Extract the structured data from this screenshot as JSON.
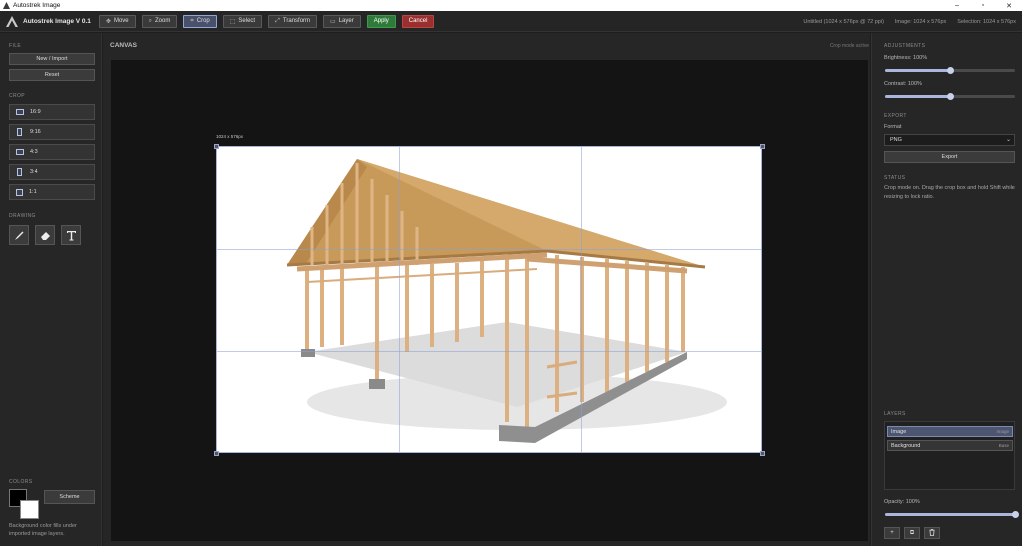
{
  "window": {
    "title": "Autostrek Image",
    "controls": [
      "–",
      "▫",
      "✕"
    ]
  },
  "toolbar": {
    "brand": "Autostrek Image V 0.1",
    "buttons": [
      {
        "label": "Move",
        "icon": "move-icon",
        "glyph": "✥"
      },
      {
        "label": "Zoom",
        "icon": "zoom-icon",
        "glyph": "⌕"
      },
      {
        "label": "Crop",
        "icon": "crop-icon",
        "glyph": "⌗",
        "active": true
      },
      {
        "label": "Select",
        "icon": "select-icon",
        "glyph": "⬚"
      },
      {
        "label": "Transform",
        "icon": "transform-icon",
        "glyph": "⤢"
      },
      {
        "label": "Layer",
        "icon": "layer-icon",
        "glyph": "▭"
      },
      {
        "label": "Apply"
      },
      {
        "label": "Cancel"
      }
    ],
    "status": {
      "doc": "Untitled (1024 x 576px @ 72 ppi)",
      "image": "Image: 1024 x 576px",
      "selection": "Selection: 1024 x 576px"
    }
  },
  "left": {
    "file_title": "FILE",
    "new_import": "New / Import",
    "reset": "Reset",
    "crop_title": "CROP",
    "ratios": [
      "16:9",
      "9:16",
      "4:3",
      "3:4",
      "1:1"
    ],
    "drawing_title": "DRAWING",
    "colors_title": "COLORS",
    "scheme": "Scheme",
    "hint": "Background color fills under imported image layers."
  },
  "canvas": {
    "title": "CANVAS",
    "mode": "Crop mode active",
    "dimensions": "1024 x 576px",
    "colors": {
      "sky": "#ffffff",
      "wood": "#d7a571",
      "roof": "#c89a5a",
      "concrete": "#8f8f8f"
    }
  },
  "right": {
    "adjustments_title": "ADJUSTMENTS",
    "brightness_label": "Brightness: 100%",
    "brightness": 0.5,
    "contrast_label": "Contrast: 100%",
    "contrast": 0.5,
    "export_title": "EXPORT",
    "format_label": "Format",
    "format_value": "PNG",
    "export_btn": "Export",
    "status_title": "STATUS",
    "status_text": "Crop mode on. Drag the crop box and hold Shift while resizing to lock ratio.",
    "layers_title": "LAYERS",
    "layers": [
      {
        "name": "Image",
        "tag": "Image"
      },
      {
        "name": "Background",
        "tag": "Base"
      }
    ],
    "opacity_label": "Opacity: 100%",
    "opacity": 1.0,
    "layer_buttons": [
      "+",
      "⧉",
      "🗑"
    ]
  },
  "accent": "#aab6dc"
}
